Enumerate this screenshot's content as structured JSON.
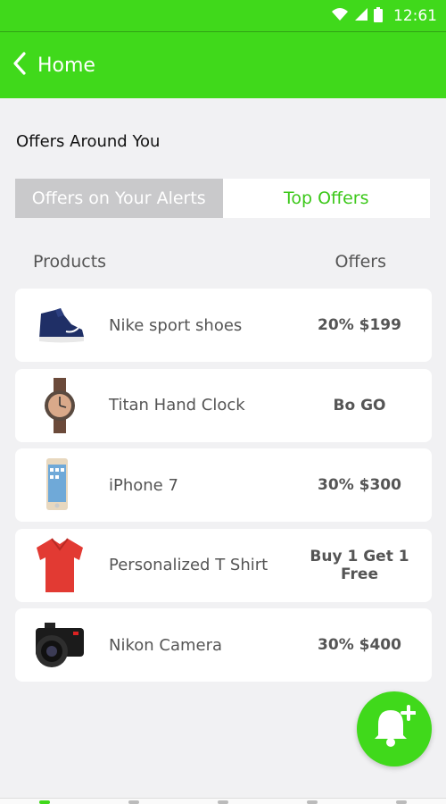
{
  "status_bar": {
    "time": "12:61"
  },
  "app_bar": {
    "back_label": "Home"
  },
  "section_title": "Offers Around You",
  "tabs": [
    {
      "label": "Offers on Your Alerts",
      "active": false
    },
    {
      "label": "Top Offers",
      "active": true
    }
  ],
  "columns": {
    "products": "Products",
    "offers": "Offers"
  },
  "products": [
    {
      "name": "Nike sport shoes",
      "offer": "20% $199",
      "icon": "shoe-icon"
    },
    {
      "name": "Titan Hand Clock",
      "offer": "Bo GO",
      "icon": "watch-icon"
    },
    {
      "name": "iPhone 7",
      "offer": "30% $300",
      "icon": "phone-icon"
    },
    {
      "name": "Personalized T Shirt",
      "offer": "Buy 1 Get 1 Free",
      "icon": "tshirt-icon"
    },
    {
      "name": "Nikon Camera",
      "offer": "30% $400",
      "icon": "camera-icon"
    }
  ],
  "colors": {
    "accent": "#40d91b",
    "tab_inactive": "#c9c9cb",
    "background": "#f1f1f3"
  }
}
